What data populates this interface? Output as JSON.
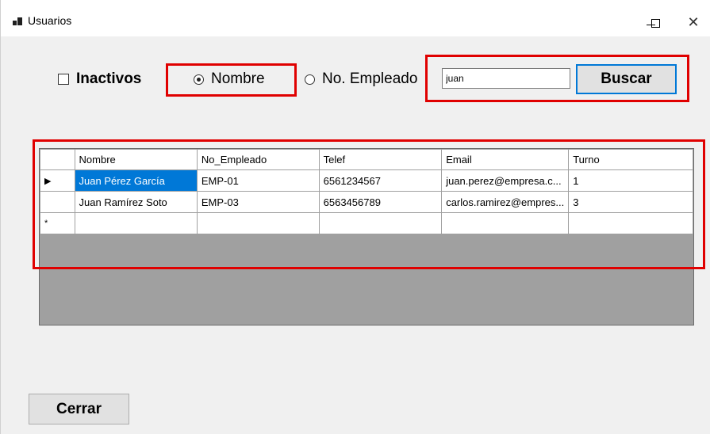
{
  "window": {
    "title": "Usuarios",
    "controls": {
      "minimize": "—",
      "maximize": "☐",
      "close": "✕"
    }
  },
  "filters": {
    "inactivos_label": "Inactivos",
    "inactivos_checked": false,
    "radio_nombre_label": "Nombre",
    "radio_nombre_checked": true,
    "radio_empleado_label": "No. Empleado",
    "radio_empleado_checked": false
  },
  "search": {
    "value": "juan",
    "button_label": "Buscar"
  },
  "grid": {
    "columns": [
      "Nombre",
      "No_Empleado",
      "Telef",
      "Email",
      "Turno"
    ],
    "rows": [
      {
        "indicator": "▶",
        "cells": [
          "Juan Pérez García",
          "EMP-01",
          "6561234567",
          "juan.perez@empresa.c...",
          "1"
        ]
      },
      {
        "indicator": "",
        "cells": [
          "Juan Ramírez Soto",
          "EMP-03",
          "6563456789",
          "carlos.ramirez@empres...",
          "3"
        ]
      }
    ],
    "new_row_indicator": "*"
  },
  "footer": {
    "close_label": "Cerrar"
  },
  "colors": {
    "highlight": "#e00000",
    "selection": "#0078d7",
    "grid_background": "#a0a0a0"
  }
}
